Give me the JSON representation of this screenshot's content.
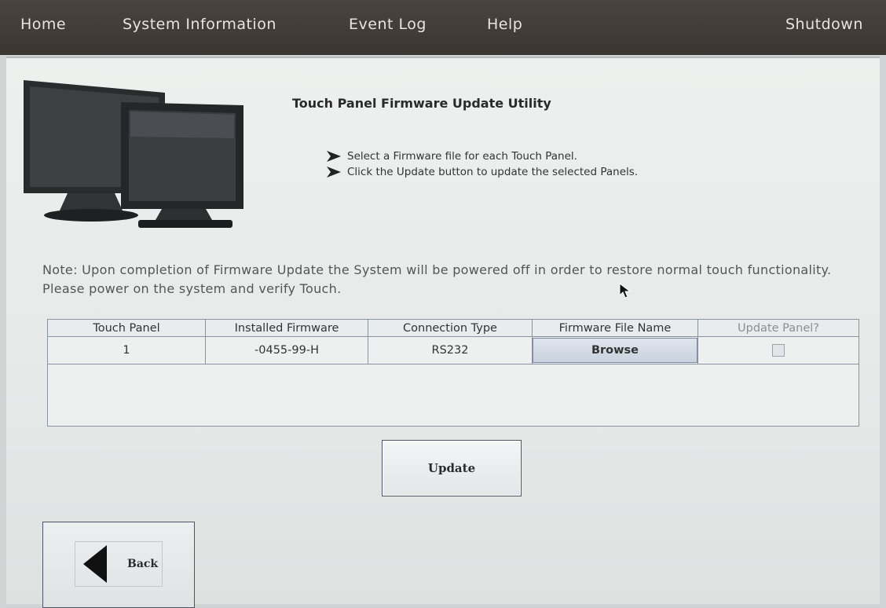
{
  "menubar": {
    "home": "Home",
    "system_information": "System Information",
    "event_log": "Event Log",
    "help": "Help",
    "shutdown": "Shutdown"
  },
  "main": {
    "title": "Touch Panel Firmware Update Utility",
    "instructions": [
      "Select a Firmware file for each Touch Panel.",
      "Click the Update button to update the selected Panels."
    ],
    "note": "Note: Upon completion of Firmware Update the System will be powered off in order to restore normal touch functionality. Please power on the system and verify Touch."
  },
  "table": {
    "headers": [
      "Touch Panel",
      "Installed Firmware",
      "Connection Type",
      "Firmware File Name",
      "Update Panel?"
    ],
    "rows": [
      {
        "touch_panel": "1",
        "installed_firmware": "-0455-99-H",
        "connection_type": "RS232",
        "browse_label": "Browse",
        "update_checked": false
      }
    ]
  },
  "buttons": {
    "update": "Update",
    "back": "Back"
  },
  "icons": {
    "monitors": "monitors-illustration",
    "back": "back-arrow-icon",
    "bullet": "arrow-bullet-icon",
    "cursor": "mouse-cursor-icon"
  }
}
